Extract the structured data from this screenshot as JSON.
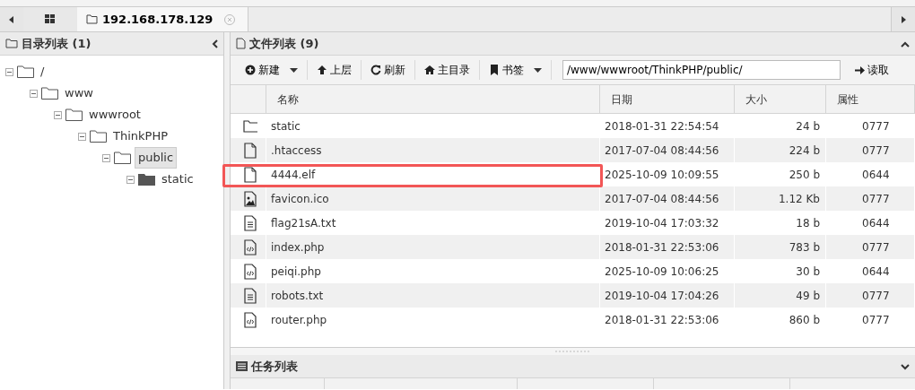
{
  "tabs": [
    {
      "kind": "home",
      "selected": false
    },
    {
      "kind": "folder",
      "label": "192.168.178.129",
      "selected": true,
      "closable": true
    }
  ],
  "dir_panel": {
    "title": "目录列表 (1)",
    "tree": [
      {
        "label": "/",
        "filled": false,
        "selected": false,
        "children": [
          {
            "label": "www",
            "filled": false,
            "selected": false,
            "children": [
              {
                "label": "wwwroot",
                "filled": false,
                "selected": false,
                "children": [
                  {
                    "label": "ThinkPHP",
                    "filled": false,
                    "selected": false,
                    "children": [
                      {
                        "label": "public",
                        "filled": false,
                        "selected": true,
                        "children": [
                          {
                            "label": "static",
                            "filled": true,
                            "selected": false
                          }
                        ]
                      }
                    ]
                  }
                ]
              }
            ]
          }
        ]
      }
    ]
  },
  "file_panel": {
    "title": "文件列表 (9)",
    "toolbar": [
      {
        "kind": "plus",
        "label": "新建",
        "dropdown": true
      },
      {
        "kind": "up",
        "label": "上层",
        "dropdown": false
      },
      {
        "kind": "refresh",
        "label": "刷新",
        "dropdown": false
      },
      {
        "kind": "home",
        "label": "主目录",
        "dropdown": false
      },
      {
        "kind": "bookmark",
        "label": "书签",
        "dropdown": true
      }
    ],
    "path": "/www/wwwroot/ThinkPHP/public/",
    "read_button": "读取",
    "columns": [
      "名称",
      "日期",
      "大小",
      "属性"
    ],
    "rows": [
      {
        "kind": "folder",
        "name": "static",
        "date": "2018-01-31 22:54:54",
        "size": "24 b",
        "mode": "0777",
        "highlighted": false
      },
      {
        "kind": "file",
        "name": ".htaccess",
        "date": "2017-07-04 08:44:56",
        "size": "224 b",
        "mode": "0777",
        "highlighted": false
      },
      {
        "kind": "file",
        "name": "4444.elf",
        "date": "2025-10-09 10:09:55",
        "size": "250 b",
        "mode": "0644",
        "highlighted": true
      },
      {
        "kind": "image",
        "name": "favicon.ico",
        "date": "2017-07-04 08:44:56",
        "size": "1.12 Kb",
        "mode": "0777",
        "highlighted": false
      },
      {
        "kind": "text",
        "name": "flag21sA.txt",
        "date": "2019-10-04 17:03:32",
        "size": "18 b",
        "mode": "0644",
        "highlighted": false
      },
      {
        "kind": "code",
        "name": "index.php",
        "date": "2018-01-31 22:53:06",
        "size": "783 b",
        "mode": "0777",
        "highlighted": false
      },
      {
        "kind": "code",
        "name": "peiqi.php",
        "date": "2025-10-09 10:06:25",
        "size": "30 b",
        "mode": "0644",
        "highlighted": false
      },
      {
        "kind": "text",
        "name": "robots.txt",
        "date": "2019-10-04 17:04:26",
        "size": "49 b",
        "mode": "0777",
        "highlighted": false
      },
      {
        "kind": "code",
        "name": "router.php",
        "date": "2018-01-31 22:53:06",
        "size": "860 b",
        "mode": "0777",
        "highlighted": false
      }
    ]
  },
  "task_panel": {
    "title": "任务列表"
  }
}
